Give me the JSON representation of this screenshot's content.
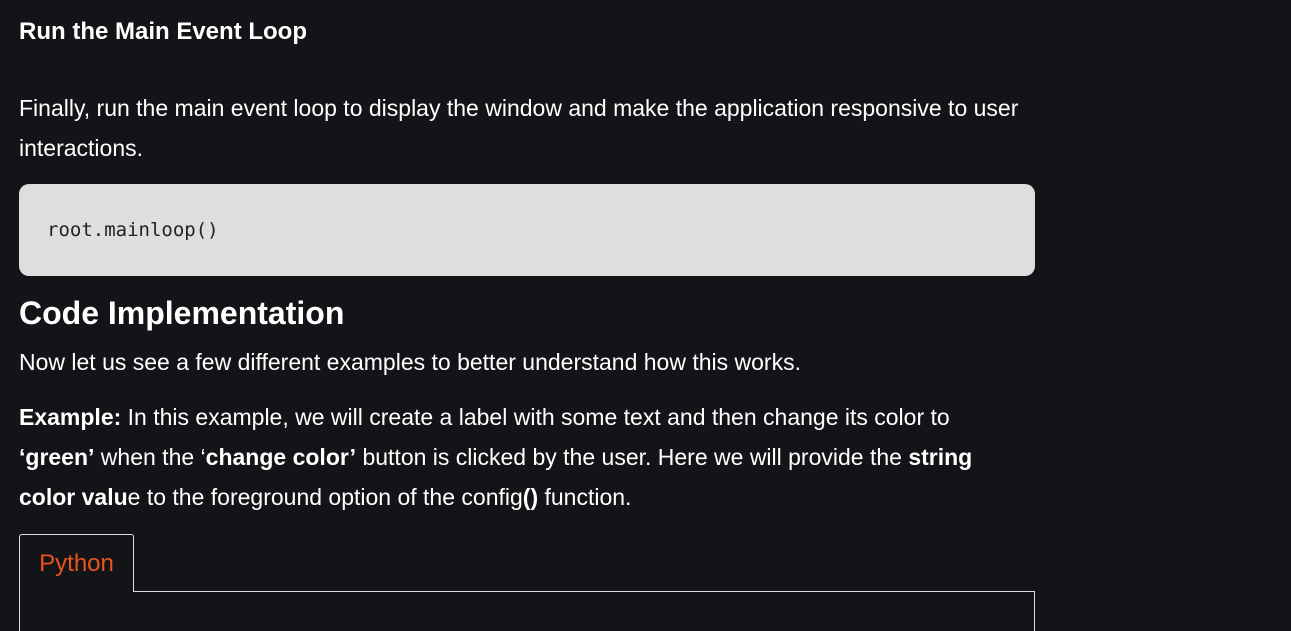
{
  "section": {
    "title": "Run the Main Event Loop"
  },
  "intro": "Finally, run the main event loop to display the window and make the application responsive to user interactions.",
  "code_block": {
    "code": "root.mainloop()"
  },
  "implementation": {
    "title": "Code Implementation",
    "lead": "Now let us see a few different examples to better understand how this works.",
    "example": {
      "label": "Example:",
      "t1": " In this example, we will create a label with some text and then change its color to ",
      "b1": "‘green’",
      "t2": " when the ‘",
      "b2": "change color’",
      "t3": " button is clicked by the user. Here we will provide the ",
      "b3": "string color valu",
      "t4": "e to the foreground option of the config",
      "b4": "()",
      "t5": " function."
    }
  },
  "tabs": [
    {
      "label": "Python",
      "active": true
    }
  ],
  "colors": {
    "background": "#131417",
    "code_bg": "#dedede",
    "tab_accent": "#e8531f"
  }
}
